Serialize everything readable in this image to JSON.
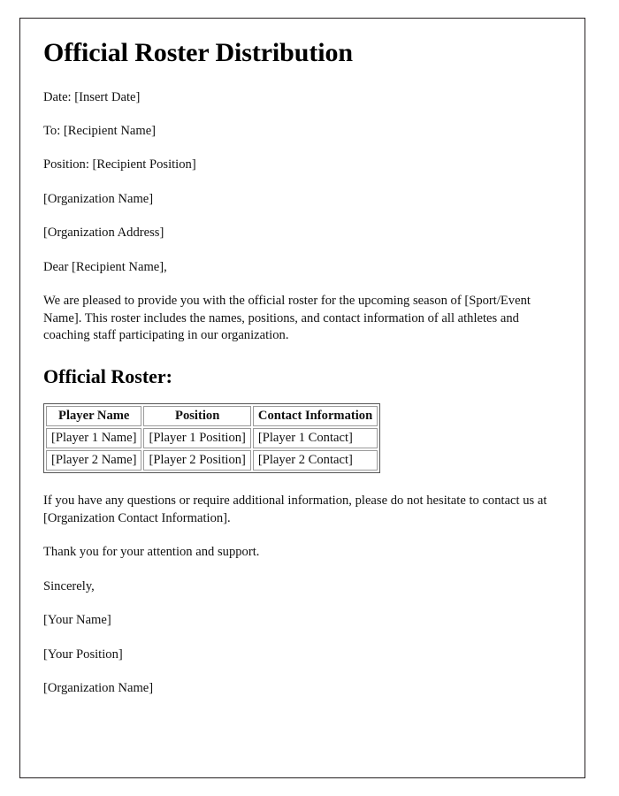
{
  "document": {
    "title": "Official Roster Distribution",
    "header_lines": [
      "Date: [Insert Date]",
      "To: [Recipient Name]",
      "Position: [Recipient Position]",
      "[Organization Name]",
      "[Organization Address]",
      "Dear [Recipient Name],"
    ],
    "intro_paragraph": "We are pleased to provide you with the official roster for the upcoming season of [Sport/Event Name]. This roster includes the names, positions, and contact information of all athletes and coaching staff participating in our organization.",
    "roster_heading": "Official Roster:",
    "roster_table": {
      "columns": [
        "Player Name",
        "Position",
        "Contact Information"
      ],
      "rows": [
        [
          "[Player 1 Name]",
          "[Player 1 Position]",
          "[Player 1 Contact]"
        ],
        [
          "[Player 2 Name]",
          "[Player 2 Position]",
          "[Player 2 Contact]"
        ]
      ]
    },
    "closing_paragraph": "If you have any questions or require additional information, please do not hesitate to contact us at [Organization Contact Information].",
    "thanks_line": "Thank you for your attention and support.",
    "signoff": "Sincerely,",
    "signature_lines": [
      "[Your Name]",
      "[Your Position]",
      "[Organization Name]"
    ]
  }
}
